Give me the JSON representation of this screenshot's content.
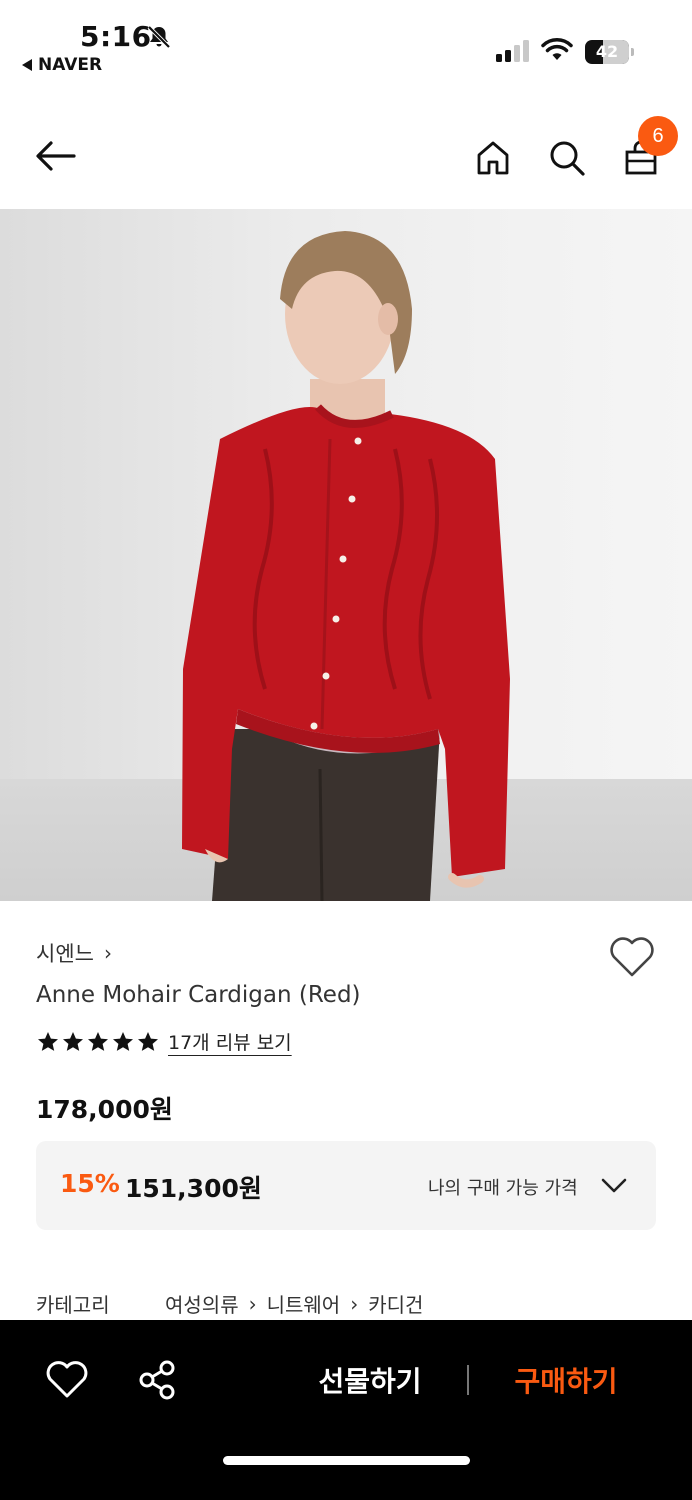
{
  "status_bar": {
    "time": "5:16",
    "back_app": "NAVER",
    "battery": "42",
    "battery_level": 0.42
  },
  "nav": {
    "cart_count": "6",
    "icons": [
      "back-arrow-icon",
      "home-icon",
      "search-icon",
      "shopping-bag-icon"
    ]
  },
  "product": {
    "brand": "시엔느",
    "title": "Anne Mohair Cardigan (Red)",
    "rating_stars": 5,
    "review_link": "17개 리뷰 보기",
    "original_price": "178,000원",
    "discount_percent": "15%",
    "discount_price": "151,300원",
    "my_price_label": "나의 구매 가능 가격",
    "category_label": "카테고리",
    "category_path": [
      "여성의류",
      "니트웨어",
      "카디건"
    ]
  },
  "bottom_bar": {
    "gift_label": "선물하기",
    "buy_label": "구매하기"
  },
  "colors": {
    "accent": "#fa5a11",
    "cardigan_red": "#c0161f",
    "bottom_bar_bg": "#000000"
  }
}
